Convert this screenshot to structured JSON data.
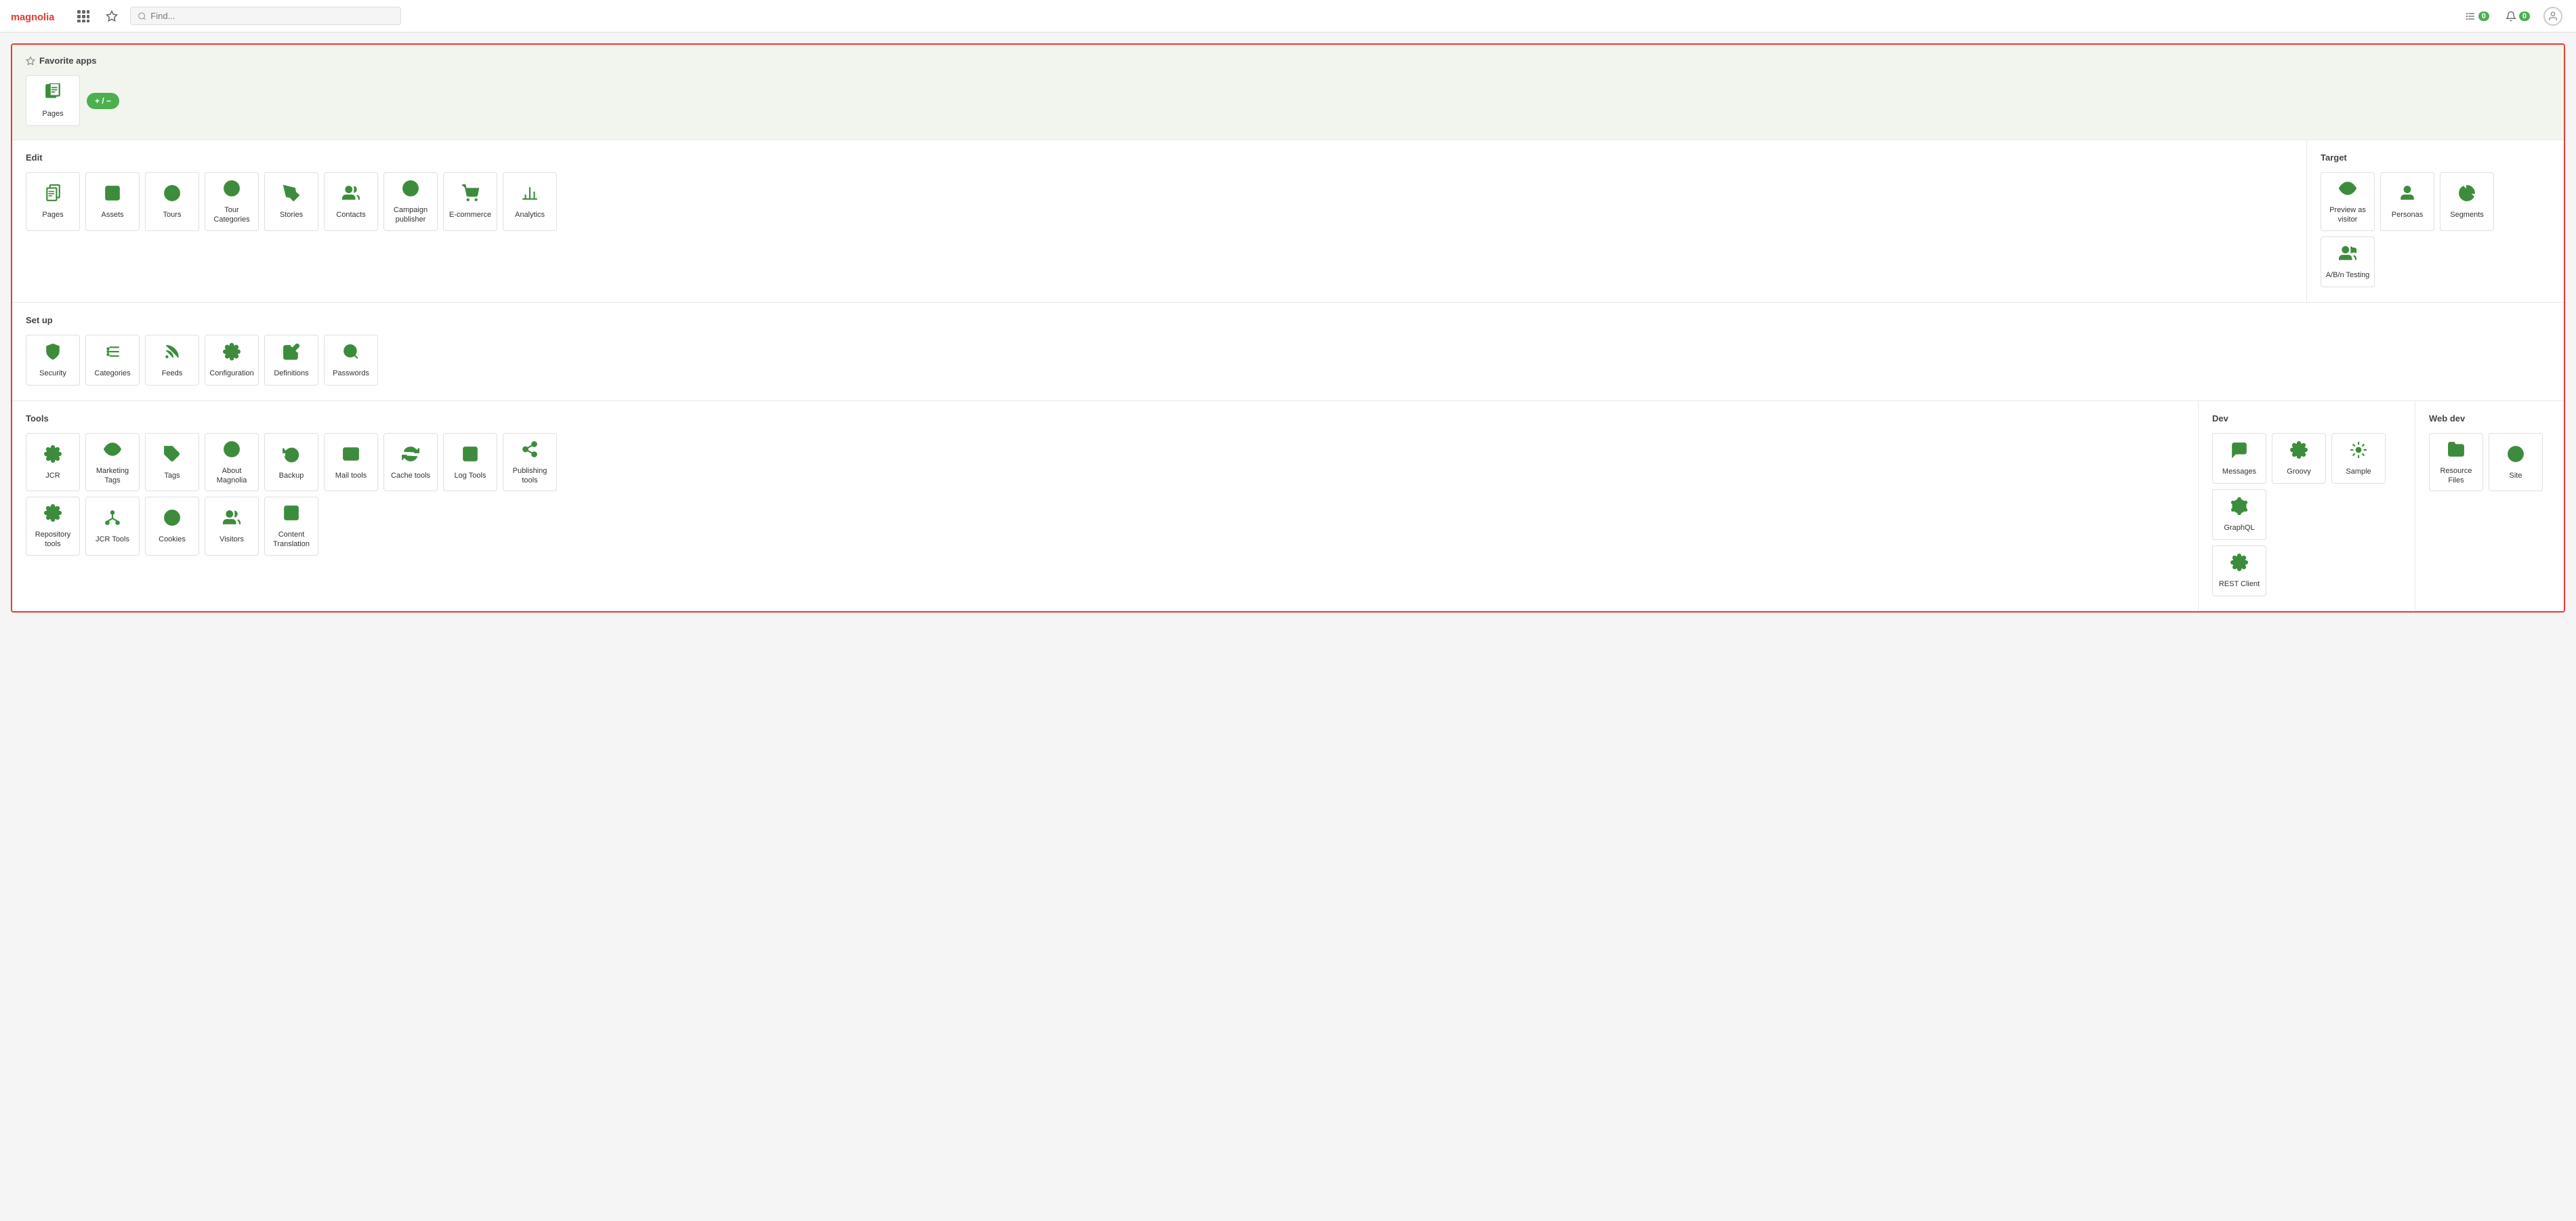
{
  "topnav": {
    "search_placeholder": "Find...",
    "tasks_label": "Tasks",
    "tasks_count": "0",
    "notifications_count": "0"
  },
  "favorites": {
    "title": "Favorite apps",
    "add_remove_label": "+ / −",
    "apps": [
      {
        "id": "pages",
        "label": "Pages",
        "icon": "pages"
      }
    ]
  },
  "sections": [
    {
      "id": "edit",
      "title": "Edit",
      "apps": [
        {
          "id": "pages2",
          "label": "Pages",
          "icon": "pages"
        },
        {
          "id": "assets",
          "label": "Assets",
          "icon": "assets"
        },
        {
          "id": "tours",
          "label": "Tours",
          "icon": "tours"
        },
        {
          "id": "tour-categories",
          "label": "Tour Categories",
          "icon": "tour-categories"
        },
        {
          "id": "stories",
          "label": "Stories",
          "icon": "stories"
        },
        {
          "id": "contacts",
          "label": "Contacts",
          "icon": "contacts"
        },
        {
          "id": "campaign-publisher",
          "label": "Campaign publisher",
          "icon": "campaign"
        },
        {
          "id": "ecommerce",
          "label": "E-commerce",
          "icon": "ecommerce"
        },
        {
          "id": "analytics",
          "label": "Analytics",
          "icon": "analytics"
        }
      ]
    },
    {
      "id": "target",
      "title": "Target",
      "apps": [
        {
          "id": "preview-visitor",
          "label": "Preview as visitor",
          "icon": "preview"
        },
        {
          "id": "personas",
          "label": "Personas",
          "icon": "personas"
        },
        {
          "id": "segments",
          "label": "Segments",
          "icon": "segments"
        },
        {
          "id": "abn-testing",
          "label": "A/B/n Testing",
          "icon": "abn"
        }
      ]
    }
  ],
  "setup": {
    "id": "setup",
    "title": "Set up",
    "apps": [
      {
        "id": "security",
        "label": "Security",
        "icon": "security"
      },
      {
        "id": "categories",
        "label": "Categories",
        "icon": "categories"
      },
      {
        "id": "feeds",
        "label": "Feeds",
        "icon": "feeds"
      },
      {
        "id": "configuration",
        "label": "Configuration",
        "icon": "configuration"
      },
      {
        "id": "definitions",
        "label": "Definitions",
        "icon": "definitions"
      },
      {
        "id": "passwords",
        "label": "Passwords",
        "icon": "passwords"
      }
    ]
  },
  "tools": {
    "id": "tools",
    "title": "Tools",
    "row1": [
      {
        "id": "jcr",
        "label": "JCR",
        "icon": "jcr"
      },
      {
        "id": "marketing-tags",
        "label": "Marketing Tags",
        "icon": "marketing-tags"
      },
      {
        "id": "tags",
        "label": "Tags",
        "icon": "tags"
      },
      {
        "id": "about-magnolia",
        "label": "About Magnolia",
        "icon": "about"
      },
      {
        "id": "backup",
        "label": "Backup",
        "icon": "backup"
      },
      {
        "id": "mail-tools",
        "label": "Mail tools",
        "icon": "mail"
      },
      {
        "id": "cache-tools",
        "label": "Cache tools",
        "icon": "cache"
      },
      {
        "id": "log-tools",
        "label": "Log Tools",
        "icon": "log"
      },
      {
        "id": "publishing-tools",
        "label": "Publishing tools",
        "icon": "publishing"
      }
    ],
    "row2": [
      {
        "id": "repository-tools",
        "label": "Repository tools",
        "icon": "repository"
      },
      {
        "id": "jcr-tools",
        "label": "JCR Tools",
        "icon": "jcr-tools"
      },
      {
        "id": "cookies",
        "label": "Cookies",
        "icon": "cookies"
      },
      {
        "id": "visitors",
        "label": "Visitors",
        "icon": "visitors"
      },
      {
        "id": "content-translation",
        "label": "Content Translation",
        "icon": "content-translation"
      }
    ]
  },
  "dev": {
    "id": "dev",
    "title": "Dev",
    "row1": [
      {
        "id": "messages",
        "label": "Messages",
        "icon": "messages"
      },
      {
        "id": "groovy",
        "label": "Groovy",
        "icon": "groovy"
      },
      {
        "id": "sample",
        "label": "Sample",
        "icon": "sample"
      },
      {
        "id": "graphql",
        "label": "GraphQL",
        "icon": "graphql"
      }
    ],
    "row2": [
      {
        "id": "rest-client",
        "label": "REST Client",
        "icon": "rest"
      }
    ]
  },
  "webdev": {
    "id": "webdev",
    "title": "Web dev",
    "row1": [
      {
        "id": "resource-files",
        "label": "Resource Files",
        "icon": "resource"
      },
      {
        "id": "site",
        "label": "Site",
        "icon": "site"
      }
    ]
  },
  "icons": {
    "pages": "📄",
    "assets": "🖼",
    "tours": "🌐",
    "tour-categories": "⚙",
    "stories": "✏",
    "contacts": "👥",
    "campaign": "📢",
    "ecommerce": "🛒",
    "analytics": "📊",
    "preview": "👁",
    "personas": "👤",
    "segments": "🥧",
    "abn": "👥",
    "security": "🛡",
    "categories": "⚙",
    "feeds": "📡",
    "configuration": "⚙",
    "definitions": "✏",
    "passwords": "🔍",
    "jcr": "⚙",
    "marketing-tags": "👁",
    "tags": "🏷",
    "about": "ℹ",
    "backup": "♻",
    "mail": "✉",
    "cache": "🔄",
    "log": "📋",
    "publishing": "📤",
    "repository": "⚙",
    "jcr-tools": "⚙",
    "cookies": "🍪",
    "visitors": "👥",
    "content-translation": "📝",
    "messages": "💬",
    "groovy": "⚙",
    "sample": "⚙",
    "graphql": "⚙",
    "rest": "⚙",
    "resource": "📁",
    "site": "🌐"
  }
}
